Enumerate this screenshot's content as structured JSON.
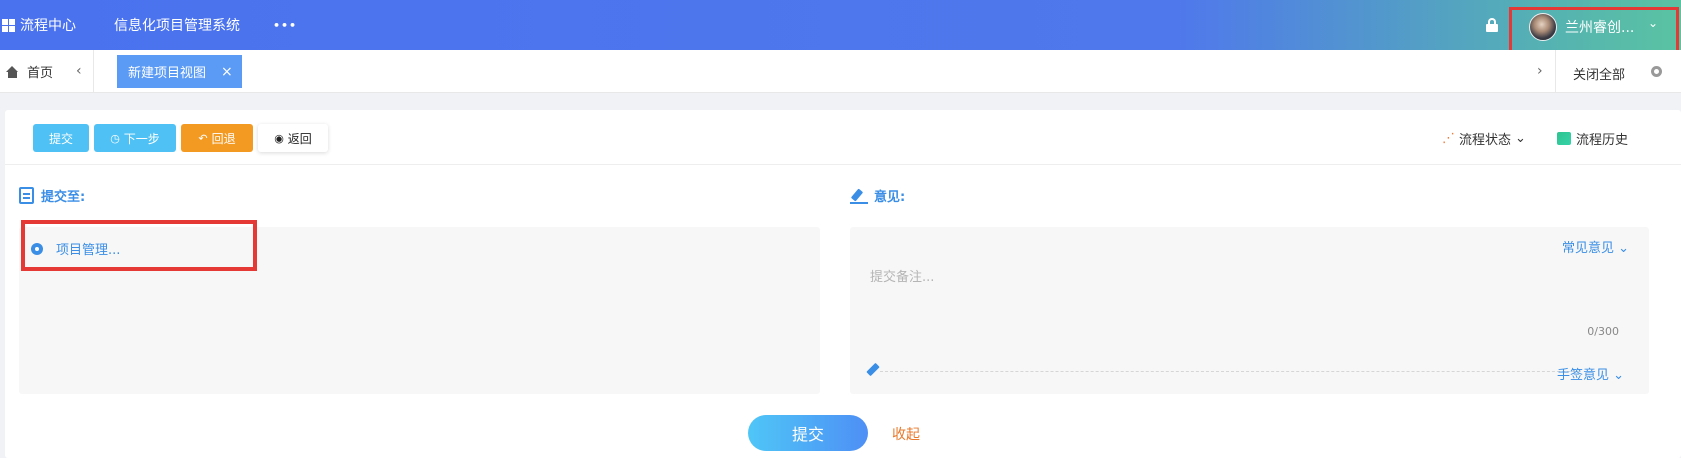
{
  "topbar": {
    "menu_items": [
      "流程中心",
      "信息化项目管理系统",
      "•••"
    ],
    "user_name": "兰州睿创...",
    "icons": [
      "grid-icon",
      "lock-icon",
      "avatar",
      "chevron-down-icon"
    ],
    "gradient_colors": [
      "#4a72ef",
      "#5ac3a2"
    ]
  },
  "tabs": {
    "home_label": "首页",
    "active_label": "新建项目视图",
    "close_glyph": "×",
    "prev_glyph": "‹",
    "next_glyph": "›",
    "close_all_label": "关闭全部"
  },
  "toolbar": {
    "submit_label": "提交",
    "next_label": "下一步",
    "back_label": "回退",
    "return_label": "返回",
    "flow_status_label": "流程状态",
    "flow_history_label": "流程历史",
    "caret": "⌄"
  },
  "form": {
    "submit_to_title": "提交至:",
    "option_label": "项目管理...",
    "opinion_title": "意见:",
    "common_opinion_label": "常见意见",
    "placeholder": "提交备注...",
    "counter": "0/300",
    "sign_opinion_label": "手签意见"
  },
  "footer": {
    "submit_label": "提交",
    "collapse_label": "收起"
  },
  "colors": {
    "accent_blue": "#3a8ee6",
    "button_blue": "#4fc1f5",
    "button_orange": "#f39a23",
    "highlight_red": "#e53935",
    "collapse_orange": "#e8792b"
  }
}
